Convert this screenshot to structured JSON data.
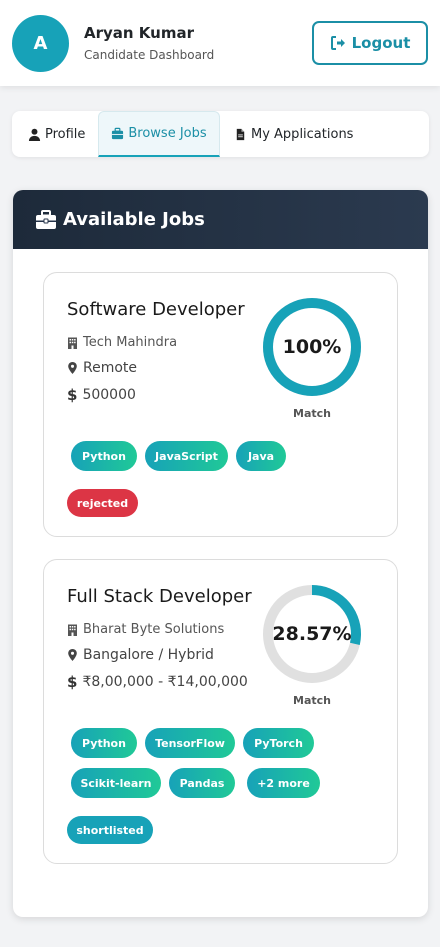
{
  "header": {
    "avatar_initial": "A",
    "user_name": "Aryan Kumar",
    "subtitle": "Candidate Dashboard",
    "logout_label": "Logout",
    "logout_icon": "sign-out-icon"
  },
  "tabs": [
    {
      "label": "Profile",
      "icon": "user-icon",
      "active": false
    },
    {
      "label": "Browse Jobs",
      "icon": "briefcase-icon",
      "active": true
    },
    {
      "label": "My Applications",
      "icon": "file-icon",
      "active": false
    }
  ],
  "panel": {
    "title": "Available Jobs",
    "icon": "briefcase-icon"
  },
  "jobs": [
    {
      "title": "Software Developer",
      "company": "Tech Mahindra",
      "location": "Remote",
      "salary": "500000",
      "match_text": "100%",
      "match_fraction": 1.0,
      "match_label": "Match",
      "skills": [
        "Python",
        "JavaScript",
        "Java"
      ],
      "status": "rejected",
      "status_color": "#dc3545"
    },
    {
      "title": "Full Stack Developer",
      "company": "Bharat Byte Solutions",
      "location": "Bangalore / Hybrid",
      "salary": "₹8,00,000 - ₹14,00,000",
      "match_text": "28.57%",
      "match_fraction": 0.2857,
      "match_label": "Match",
      "skills": [
        "Python",
        "TensorFlow",
        "PyTorch",
        "Scikit-learn",
        "Pandas",
        "+2 more"
      ],
      "status": "shortlisted",
      "status_color": "#17a2b8"
    }
  ],
  "colors": {
    "accent": "#17a2b8",
    "ring_track": "#e0e0e0",
    "panel_header": "#1d2a3a"
  }
}
